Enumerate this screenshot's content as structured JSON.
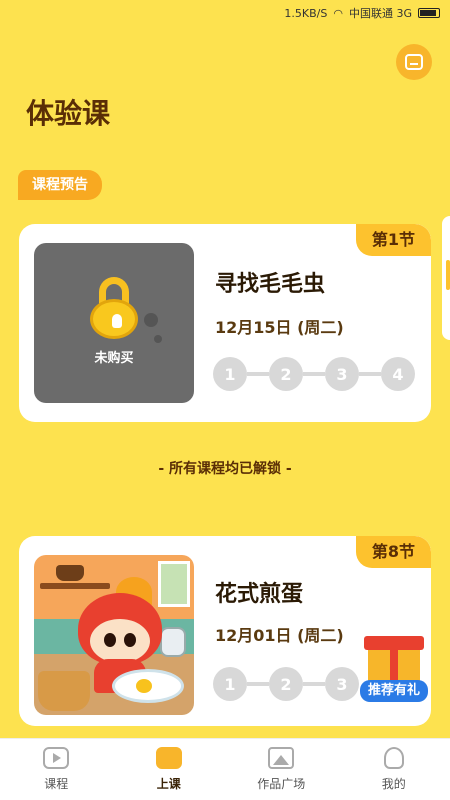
{
  "status_bar": {
    "speed": "1.5KB/S",
    "carrier": "中国联通 3G"
  },
  "page": {
    "title": "体验课"
  },
  "section": {
    "chip": "课程预告"
  },
  "cards": [
    {
      "badge": "第1节",
      "title": "寻找毛毛虫",
      "date": "12月15日 (周二)",
      "thumb_text": "未购买",
      "steps": [
        "1",
        "2",
        "3",
        "4"
      ]
    },
    {
      "badge": "第8节",
      "title": "花式煎蛋",
      "date": "12月01日 (周二)",
      "steps": [
        "1",
        "2",
        "3"
      ]
    }
  ],
  "unlock_note": "- 所有课程均已解锁 -",
  "gift": {
    "label": "推荐有礼"
  },
  "tabs": [
    {
      "label": "课程",
      "icon": "play-icon"
    },
    {
      "label": "上课",
      "icon": "class-icon"
    },
    {
      "label": "作品广场",
      "icon": "gallery-icon"
    },
    {
      "label": "我的",
      "icon": "profile-icon"
    }
  ],
  "colors": {
    "background": "#FDE24F",
    "accent": "#F8A921",
    "badge": "#FDC22E",
    "gift_label": "#2B7BE6"
  }
}
